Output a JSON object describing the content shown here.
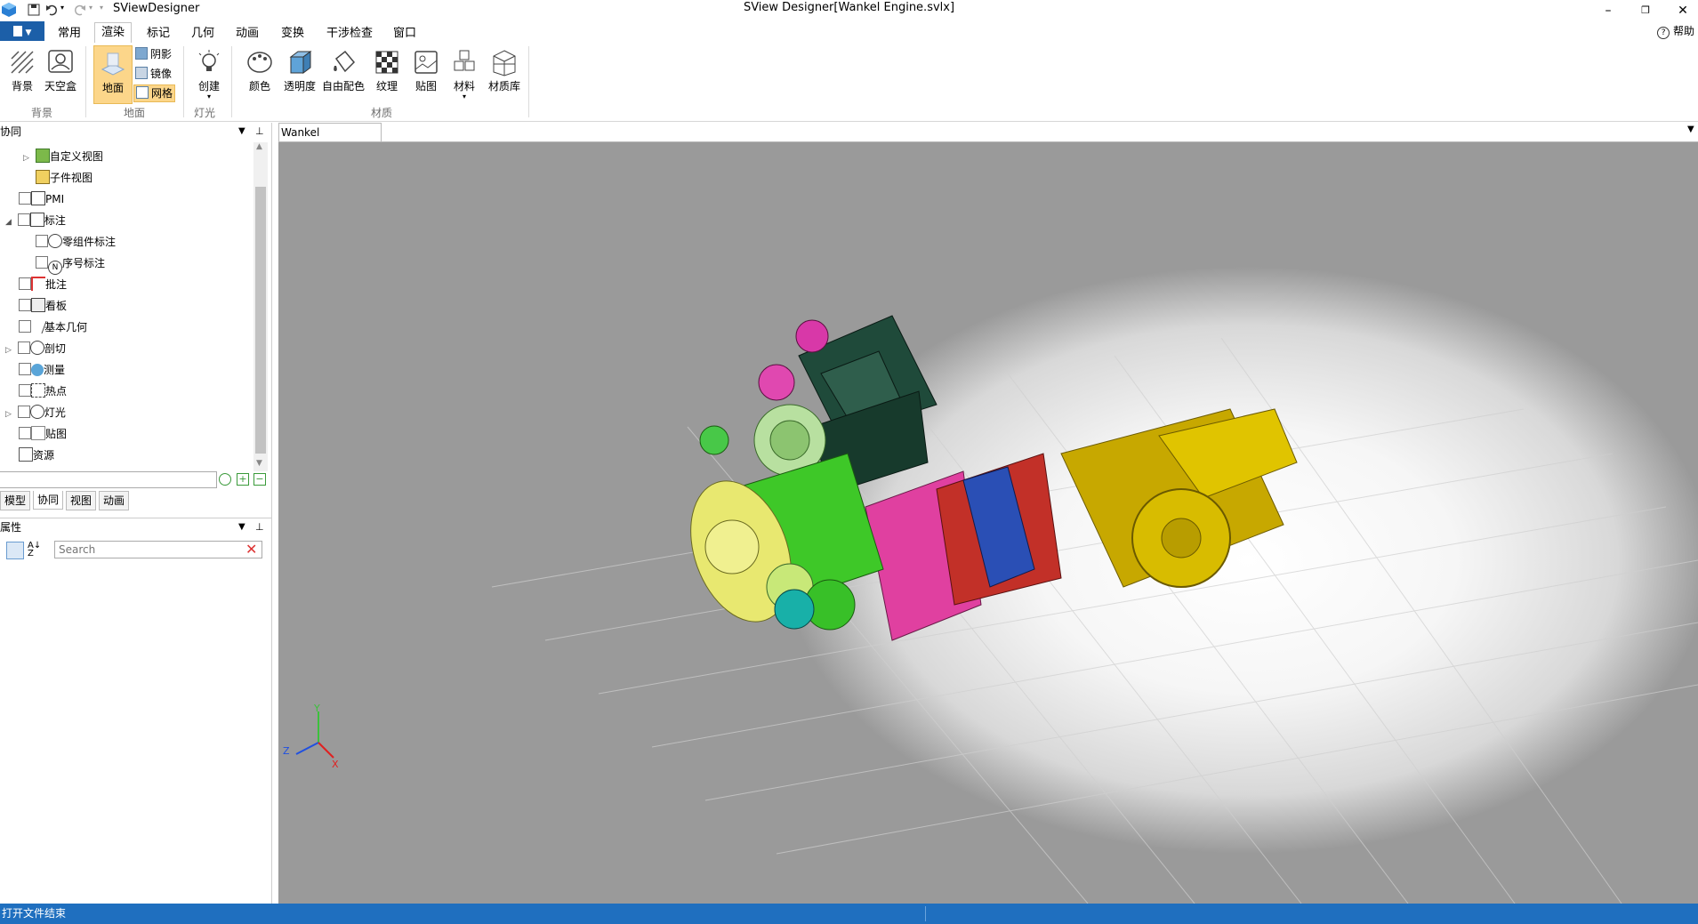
{
  "app": {
    "title": "SViewDesigner",
    "document_title": "SView Designer[Wankel Engine.svlx]"
  },
  "window_controls": {
    "minimize": "–",
    "restore": "❐",
    "close": "✕"
  },
  "ribbon": {
    "tabs": [
      "常用",
      "渲染",
      "标记",
      "几何",
      "动画",
      "变换",
      "干涉检查",
      "窗口"
    ],
    "active_tab": "渲染",
    "help_label": "帮助",
    "groups": {
      "background": {
        "label": "背景",
        "buttons": [
          "背景",
          "天空盒"
        ]
      },
      "ground": {
        "label": "地面",
        "main_button": "地面",
        "small_buttons": [
          "阴影",
          "镜像",
          "网格"
        ]
      },
      "light": {
        "label": "灯光",
        "button": "创建"
      },
      "material": {
        "label": "材质",
        "buttons": [
          "颜色",
          "透明度",
          "自由配色",
          "纹理",
          "贴图",
          "材料",
          "材质库"
        ]
      }
    }
  },
  "left_panel": {
    "collab_header": "协同",
    "tree": [
      {
        "label": "自定义视图",
        "level": 1,
        "checkbox": false,
        "expander": "▷"
      },
      {
        "label": "子件视图",
        "level": 1,
        "checkbox": false,
        "expander": ""
      },
      {
        "label": "PMI",
        "level": 0,
        "checkbox": true,
        "expander": ""
      },
      {
        "label": "标注",
        "level": 0,
        "checkbox": true,
        "expander": "◢"
      },
      {
        "label": "零组件标注",
        "level": 1,
        "checkbox": true,
        "expander": ""
      },
      {
        "label": "序号标注",
        "level": 1,
        "checkbox": true,
        "expander": ""
      },
      {
        "label": "批注",
        "level": 0,
        "checkbox": true,
        "expander": ""
      },
      {
        "label": "看板",
        "level": 0,
        "checkbox": true,
        "expander": ""
      },
      {
        "label": "基本几何",
        "level": 0,
        "checkbox": true,
        "expander": ""
      },
      {
        "label": "剖切",
        "level": 0,
        "checkbox": true,
        "expander": "▷"
      },
      {
        "label": "测量",
        "level": 0,
        "checkbox": true,
        "expander": ""
      },
      {
        "label": "热点",
        "level": 0,
        "checkbox": true,
        "expander": ""
      },
      {
        "label": "灯光",
        "level": 0,
        "checkbox": true,
        "expander": "▷"
      },
      {
        "label": "贴图",
        "level": 0,
        "checkbox": true,
        "expander": ""
      },
      {
        "label": "资源",
        "level": 0,
        "checkbox": false,
        "expander": ""
      }
    ],
    "bottom_tabs": [
      "模型",
      "协同",
      "视图",
      "动画"
    ],
    "active_bottom_tab": "协同",
    "properties_header": "属性",
    "search_placeholder": "Search"
  },
  "document": {
    "tab_label": "Wankel Engine.svlx"
  },
  "axes": {
    "y": "Y",
    "z": "Z",
    "x": "X"
  },
  "status": {
    "text": "打开文件结束"
  },
  "colors": {
    "accent": "#1f6fbf",
    "ground_active": "#fcd68a"
  }
}
